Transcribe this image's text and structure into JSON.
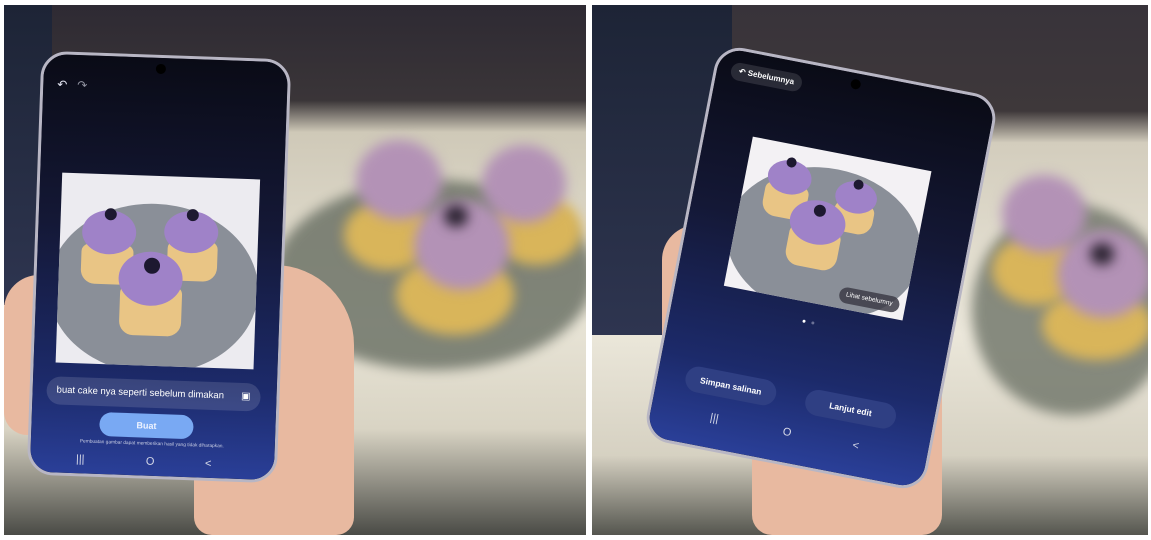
{
  "left_phone": {
    "prompt_text": "buat cake nya seperti sebelum dimakan",
    "generate_button": "Buat",
    "disclaimer": "Pembuatan gambar dapat memberikan hasil yang tidak diharapkan.",
    "nav": {
      "recents": "|||",
      "home": "O",
      "back": "<"
    }
  },
  "right_phone": {
    "back_label": "Sebelumnya",
    "view_previous_button": "Lihat sebelumny",
    "save_copy_button": "Simpan salinan",
    "continue_edit_button": "Lanjut edit",
    "nav": {
      "recents": "|||",
      "home": "O",
      "back": "<"
    }
  },
  "icons": {
    "undo": "undo-icon",
    "redo": "redo-icon",
    "image": "image-icon",
    "back_arrow": "back-arrow-icon"
  },
  "colors": {
    "screen_bg": "#141836",
    "accent_button": "#6fa6f3",
    "pill_bg": "#2f3f83"
  }
}
